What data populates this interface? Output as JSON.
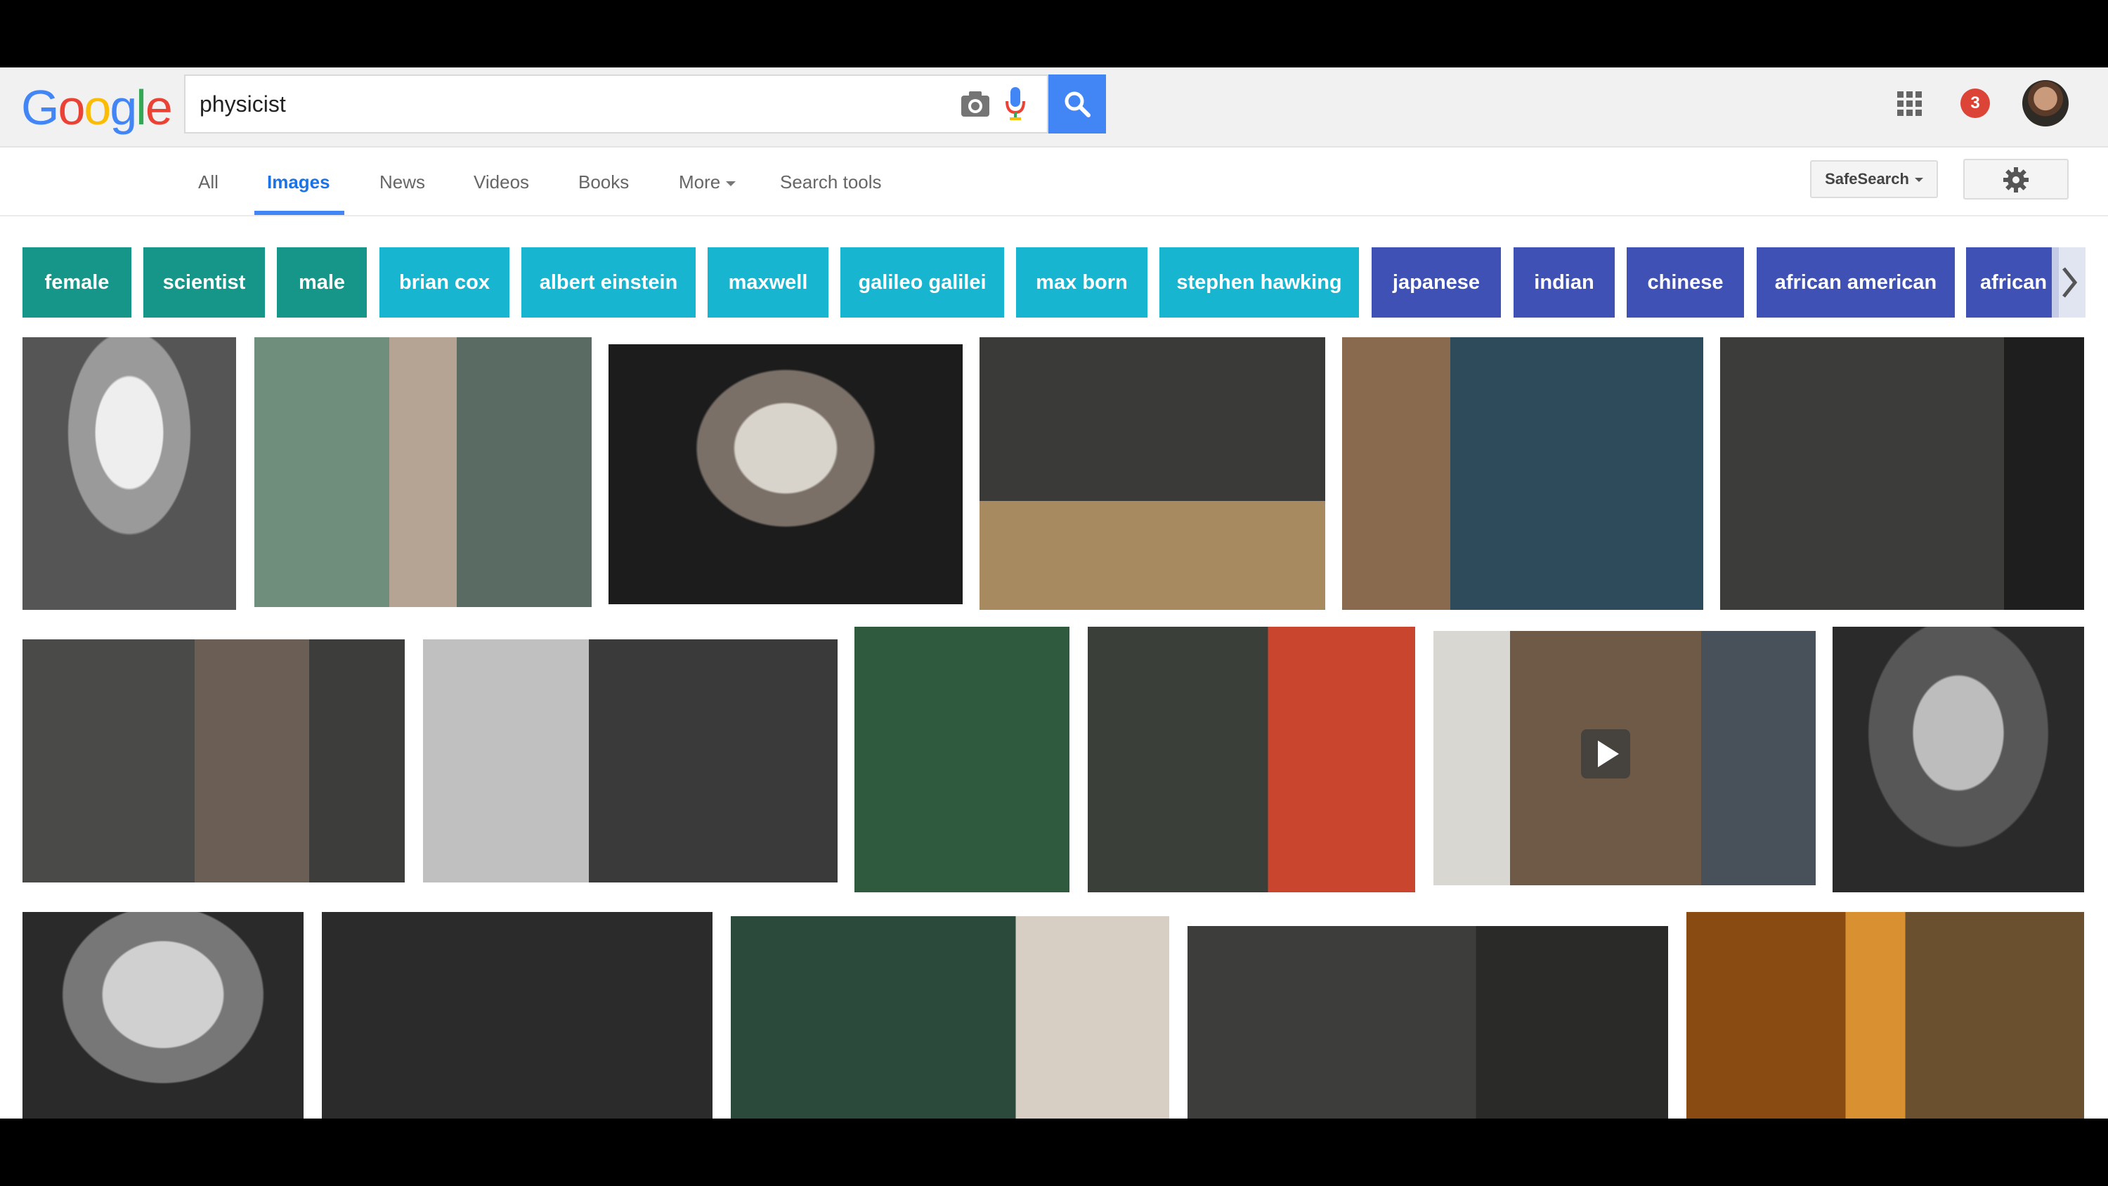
{
  "logo": {
    "letters": [
      "G",
      "o",
      "o",
      "g",
      "l",
      "e"
    ],
    "colors": [
      "#4285f4",
      "#ea4335",
      "#fbbc05",
      "#4285f4",
      "#34a853",
      "#ea4335"
    ]
  },
  "search": {
    "query": "physicist"
  },
  "header": {
    "notification_count": "3"
  },
  "tabs": {
    "all": "All",
    "images": "Images",
    "news": "News",
    "videos": "Videos",
    "books": "Books",
    "more": "More",
    "search_tools": "Search tools"
  },
  "safesearch_label": "SafeSearch",
  "chips": [
    {
      "label": "female",
      "color": "#169688"
    },
    {
      "label": "scientist",
      "color": "#169688"
    },
    {
      "label": "male",
      "color": "#169688"
    },
    {
      "label": "brian cox",
      "color": "#17b5d0"
    },
    {
      "label": "albert einstein",
      "color": "#17b5d0"
    },
    {
      "label": "maxwell",
      "color": "#17b5d0"
    },
    {
      "label": "galileo galilei",
      "color": "#17b5d0"
    },
    {
      "label": "max born",
      "color": "#17b5d0"
    },
    {
      "label": "stephen hawking",
      "color": "#17b5d0"
    },
    {
      "label": "japanese",
      "color": "#3f51b5"
    },
    {
      "label": "indian",
      "color": "#3f51b5"
    },
    {
      "label": "chinese",
      "color": "#3f51b5"
    },
    {
      "label": "african american",
      "color": "#3f51b5"
    },
    {
      "label": "african",
      "color": "#3f51b5"
    }
  ],
  "icons": [
    "camera-icon",
    "microphone-icon",
    "search-icon",
    "apps-grid-icon",
    "avatar",
    "gear-icon",
    "chevron-right-icon",
    "play-icon"
  ]
}
